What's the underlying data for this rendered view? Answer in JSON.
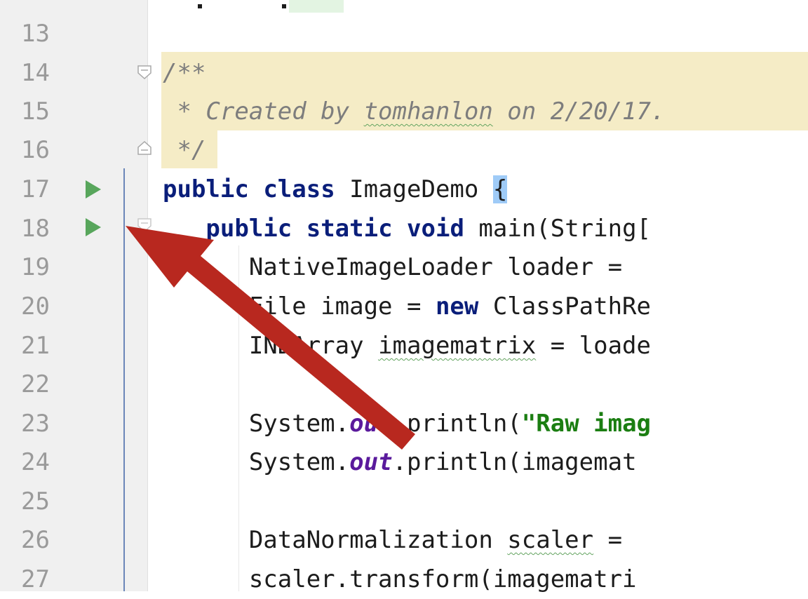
{
  "gutter": {
    "line_numbers": [
      "13",
      "14",
      "15",
      "16",
      "17",
      "18",
      "19",
      "20",
      "21",
      "22",
      "23",
      "24",
      "25",
      "26",
      "27"
    ],
    "run_markers": [
      {
        "line": "17",
        "icon": "run-icon",
        "color": "#58a65c"
      },
      {
        "line": "18",
        "icon": "run-icon",
        "color": "#58a65c"
      }
    ]
  },
  "code": {
    "l14_comment": "/**",
    "l15_comment_prefix": " * Created by ",
    "l15_author": "tomhanlon",
    "l15_comment_suffix": " on 2/20/17.",
    "l16_comment": " */",
    "l17_kw1": "public",
    "l17_kw2": "class",
    "l17_name": " ImageDemo ",
    "l17_brace": "{",
    "l18_kw1": "public",
    "l18_kw2": "static",
    "l18_kw3": "void",
    "l18_rest": " main(String[",
    "l19": "NativeImageLoader loader = ",
    "l20_pre": "File image = ",
    "l20_kw": "new",
    "l20_post": " ClassPathRe",
    "l21_pre": "INDArray ",
    "l21_var": "imagematrix",
    "l21_post": " = loade",
    "l23_pre": "System.",
    "l23_field": "out",
    "l23_mid": ".println(",
    "l23_str": "\"Raw imag",
    "l24_pre": "System.",
    "l24_field": "out",
    "l24_post": ".println(imagemat",
    "l26_pre": "DataNormalization ",
    "l26_var": "scaler",
    "l26_post": " = ",
    "l27": "scaler.transform(imagematri"
  },
  "annotation": {
    "icon": "red-arrow-icon",
    "color": "#b8281f"
  },
  "colors": {
    "keyword": "#0a1e7a",
    "comment_bg": "#f5ecc6",
    "string": "#1b7e12",
    "static_field": "#5a1a9c",
    "gutter_bg": "#f0f0f0"
  }
}
